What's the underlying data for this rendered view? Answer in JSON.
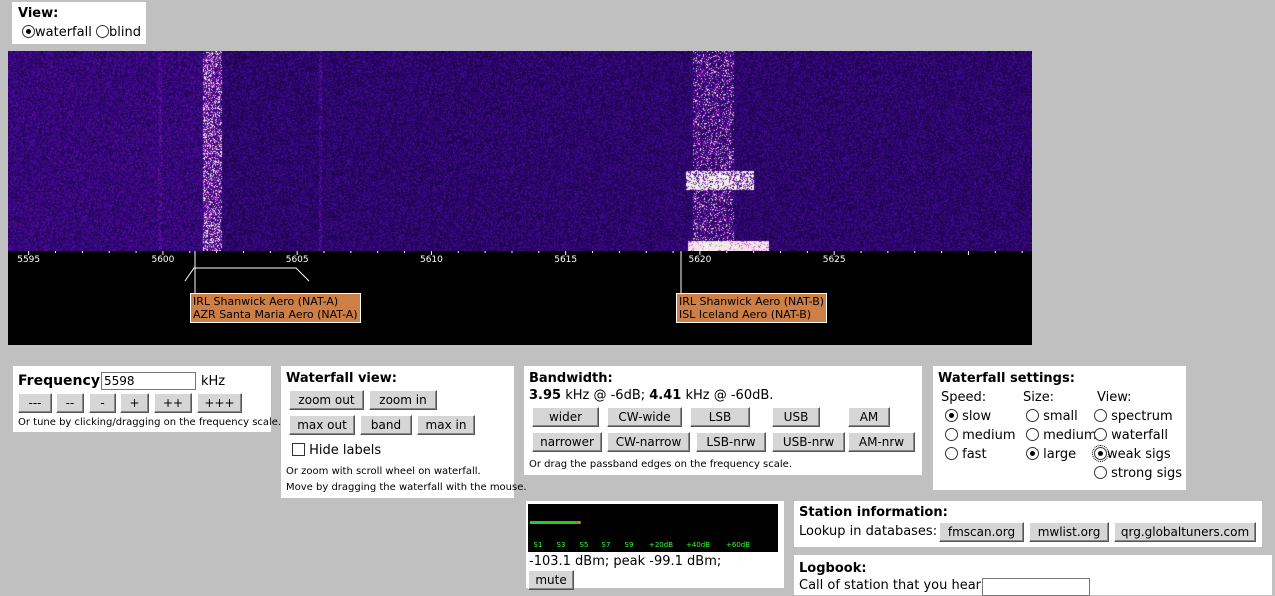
{
  "view_panel": {
    "title": "View:",
    "options": [
      "waterfall",
      "blind"
    ],
    "selected": "waterfall"
  },
  "scale": {
    "ticks": [
      "5595",
      "5600",
      "5605",
      "5610",
      "5615",
      "5620",
      "5625"
    ],
    "labels": [
      {
        "lines": [
          "IRL Shanwick Aero (NAT-A)",
          "AZR Santa Maria Aero (NAT-A)"
        ]
      },
      {
        "lines": [
          "IRL Shanwick Aero (NAT-B)",
          "ISL Iceland Aero (NAT-B)"
        ]
      }
    ]
  },
  "frequency": {
    "label": "Frequency:",
    "value": "5598",
    "unit": "kHz",
    "buttons": [
      "---",
      "--",
      "-",
      "+",
      "++",
      "+++"
    ],
    "hint": "Or tune by clicking/dragging on the frequency scale."
  },
  "waterfall_view": {
    "title": "Waterfall view:",
    "buttons": [
      "zoom out",
      "zoom in",
      "max out",
      "band",
      "max in"
    ],
    "hide_labels": "Hide labels",
    "hint1": "Or zoom with scroll wheel on waterfall.",
    "hint2": "Move by dragging the waterfall with the mouse."
  },
  "bandwidth": {
    "title": "Bandwidth:",
    "bw6": "3.95",
    "bw6_text": " kHz @ -6dB; ",
    "bw60": "4.41",
    "bw60_text": " kHz @ -60dB.",
    "buttons_row1": [
      "wider",
      "CW-wide",
      "LSB",
      "USB",
      "AM"
    ],
    "buttons_row2": [
      "narrower",
      "CW-narrow",
      "LSB-nrw",
      "USB-nrw",
      "AM-nrw"
    ],
    "hint": "Or drag the passband edges on the frequency scale."
  },
  "waterfall_settings": {
    "title": "Waterfall settings:",
    "speed_label": "Speed:",
    "speed_options": [
      "slow",
      "medium",
      "fast"
    ],
    "speed_selected": "slow",
    "size_label": "Size:",
    "size_options": [
      "small",
      "medium",
      "large"
    ],
    "size_selected": "large",
    "view_label": "View:",
    "view_options": [
      "spectrum",
      "waterfall",
      "weak sigs",
      "strong sigs"
    ],
    "view_selected": "weak sigs"
  },
  "smeter": {
    "scale": [
      "S1",
      "S3",
      "S5",
      "S7",
      "S9",
      "+20dB",
      "+40dB",
      "+60dB"
    ],
    "reading": "-103.1 dBm; peak  -99.1 dBm;",
    "level_fraction": 0.19,
    "mute_label": "mute",
    "bar_color": "#22cc22",
    "peak_color": "#e07020"
  },
  "station_info": {
    "title": "Station information:",
    "lookup_label": "Lookup in databases:",
    "buttons": [
      "fmscan.org",
      "mwlist.org",
      "qrg.globaltuners.com"
    ]
  },
  "logbook": {
    "title": "Logbook:",
    "call_label": "Call of station that you hear:"
  }
}
